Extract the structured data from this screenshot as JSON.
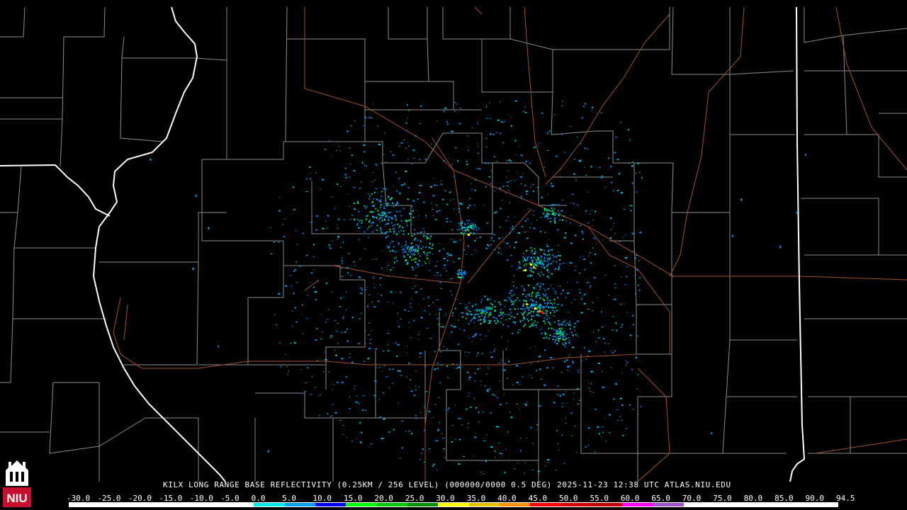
{
  "title": "KILX LONG RANGE BASE REFLECTIVITY (0.25KM / 256 LEVEL) (000000/0000 0.5 DEG) 2025-11-23 12:38 UTC  ATLAS.NIU.EDU",
  "logo": {
    "text": "NIU",
    "bg": "#c8102e"
  },
  "colors": {
    "county": "#8c8c8c",
    "state": "#ffffff",
    "highway": "#a0522d",
    "background": "#000000"
  },
  "scale": {
    "labels": [
      "-30.0",
      "-25.0",
      "-20.0",
      "-15.0",
      "-10.0",
      "-5.0",
      "0.0",
      "5.0",
      "10.0",
      "15.0",
      "20.0",
      "25.0",
      "30.0",
      "35.0",
      "40.0",
      "45.0",
      "50.0",
      "55.0",
      "60.0",
      "65.0",
      "70.0",
      "75.0",
      "80.0",
      "85.0",
      "90.0",
      "94.5"
    ],
    "colors": [
      "#ffffff",
      "#ffffff",
      "#ffffff",
      "#ffffff",
      "#ffffff",
      "#ffffff",
      "#00eaec",
      "#01a0f6",
      "#0000f6",
      "#00ff00",
      "#00c800",
      "#009000",
      "#ffff00",
      "#e7c000",
      "#ff9000",
      "#ff0000",
      "#d60000",
      "#c00000",
      "#ff00ff",
      "#9955c9",
      "#ffffff",
      "#ffffff",
      "#ffffff",
      "#ffffff",
      "#ffffff"
    ]
  }
}
